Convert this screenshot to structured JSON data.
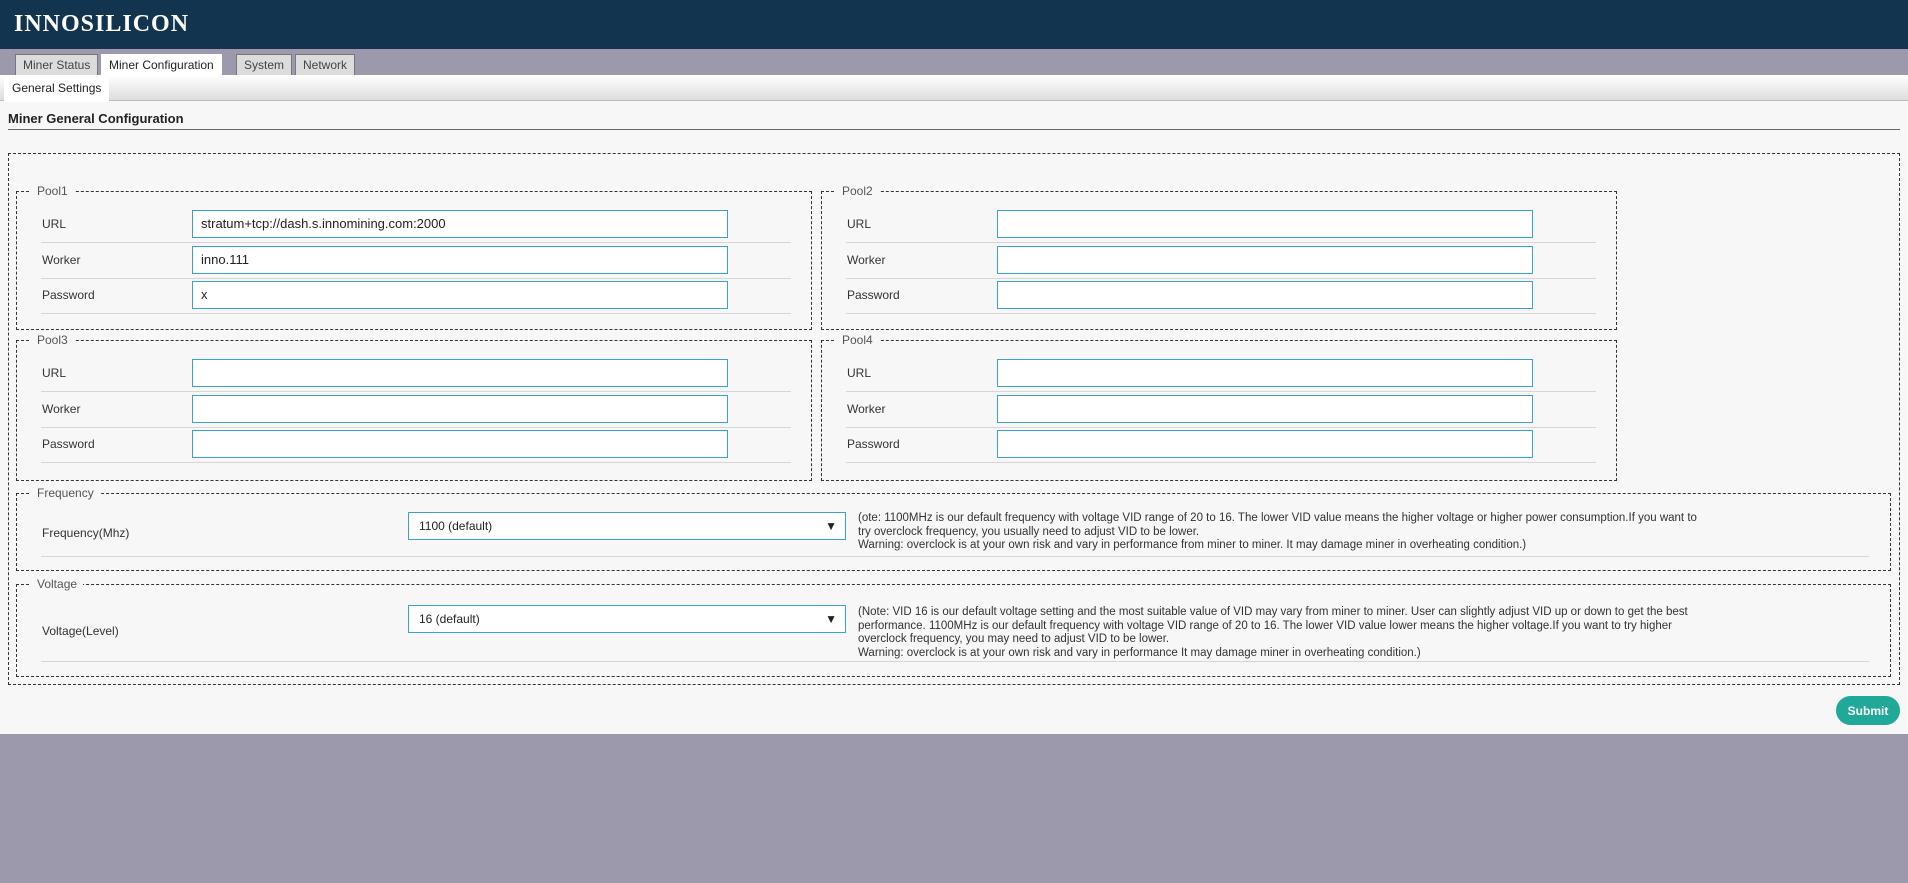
{
  "header": {
    "logo": "INNOSILICON"
  },
  "tabs": [
    {
      "label": "Miner Status"
    },
    {
      "label": "Miner Configuration"
    },
    {
      "label": "System"
    },
    {
      "label": "Network"
    }
  ],
  "subtab": "General Settings",
  "page_title": "Miner General Configuration",
  "labels": {
    "url": "URL",
    "worker": "Worker",
    "password": "Password"
  },
  "pools": [
    {
      "legend": "Pool1",
      "url": "stratum+tcp://dash.s.innomining.com:2000",
      "worker": "inno.111",
      "password": "x"
    },
    {
      "legend": "Pool2",
      "url": "",
      "worker": "",
      "password": ""
    },
    {
      "legend": "Pool3",
      "url": "",
      "worker": "",
      "password": ""
    },
    {
      "legend": "Pool4",
      "url": "",
      "worker": "",
      "password": ""
    }
  ],
  "frequency": {
    "legend": "Frequency",
    "label": "Frequency(Mhz)",
    "value": "1100 (default)",
    "note": [
      "(ote: 1100MHz is our default frequency with voltage VID range of 20 to 16. The lower VID value means the higher voltage or higher power consumption.If you want to",
      "try overclock frequency, you usually need to adjust VID to be lower.",
      "Warning: overclock is at your own risk and vary in performance from miner to miner. It may damage miner in overheating condition.)"
    ]
  },
  "voltage": {
    "legend": "Voltage",
    "label": "Voltage(Level)",
    "value": "16 (default)",
    "note": [
      "(Note: VID 16 is our default voltage setting and the most suitable value of VID may vary from miner to miner. User can slightly adjust VID up or down to get the best",
      "performance. 1100MHz is our default frequency with voltage VID range of 20 to 16. The lower VID value lower means the higher voltage.If you want to try higher",
      "overclock frequency, you may need to adjust VID to be lower.",
      "Warning: overclock is at your own risk and vary in performance  It may damage miner in overheating condition.)"
    ]
  },
  "submit_label": "Submit",
  "colors": {
    "header": "#12344e",
    "accent": "#3aa3c7",
    "submit": "#20a898"
  }
}
